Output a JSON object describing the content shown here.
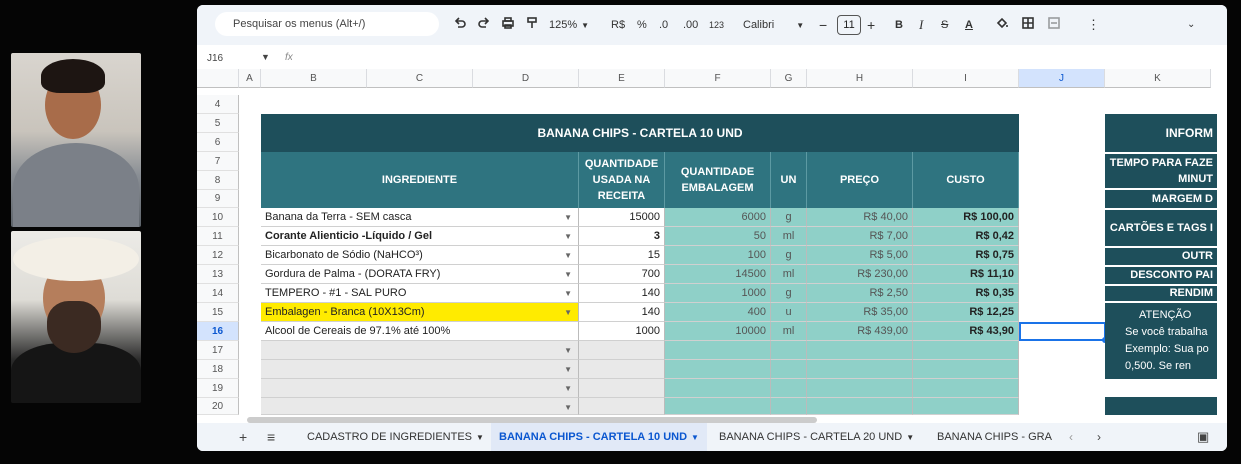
{
  "toolbar": {
    "search_placeholder": "Pesquisar os menus (Alt+/)",
    "zoom": "125%",
    "currency": "R$",
    "percent": "%",
    "dec_decrease": ".0",
    "dec_increase": ".00",
    "number_format": "123",
    "font": "Calibri",
    "font_size": "11",
    "bold": "B",
    "italic": "I",
    "strike": "S",
    "text_color": "A"
  },
  "formula_bar": {
    "cell_ref": "J16",
    "fx": "fx"
  },
  "columns": [
    "A",
    "B",
    "C",
    "D",
    "E",
    "F",
    "G",
    "H",
    "I",
    "J",
    "K"
  ],
  "rows": [
    "4",
    "5",
    "6",
    "7",
    "8",
    "9",
    "10",
    "11",
    "12",
    "13",
    "14",
    "15",
    "16",
    "17",
    "18",
    "19",
    "20"
  ],
  "table": {
    "title": "BANANA CHIPS - CARTELA 10 UND",
    "headers": {
      "ingrediente": "INGREDIENTE",
      "qtd_receita": [
        "QUANTIDADE",
        "USADA NA",
        "RECEITA"
      ],
      "qtd_embalagem": [
        "QUANTIDADE",
        "EMBALAGEM"
      ],
      "un": "UN",
      "preco": "PREÇO",
      "custo": "CUSTO"
    },
    "items": [
      {
        "ingrediente": "Banana da Terra - SEM casca",
        "qtd": "15000",
        "emb": "6000",
        "un": "g",
        "preco": "R$ 40,00",
        "custo": "R$ 100,00"
      },
      {
        "ingrediente": "Corante Alienticio -Líquido / Gel",
        "qtd": "3",
        "emb": "50",
        "un": "ml",
        "preco": "R$ 7,00",
        "custo": "R$ 0,42"
      },
      {
        "ingrediente": "Bicarbonato de Sódio (NaHCO³)",
        "qtd": "15",
        "emb": "100",
        "un": "g",
        "preco": "R$ 5,00",
        "custo": "R$ 0,75"
      },
      {
        "ingrediente": "Gordura de Palma - (DORATA FRY)",
        "qtd": "700",
        "emb": "14500",
        "un": "ml",
        "preco": "R$ 230,00",
        "custo": "R$ 11,10"
      },
      {
        "ingrediente": "TEMPERO - #1 - SAL PURO",
        "qtd": "140",
        "emb": "1000",
        "un": "g",
        "preco": "R$ 2,50",
        "custo": "R$ 0,35"
      },
      {
        "ingrediente": "Embalagen - Branca (10X13Cm)",
        "qtd": "140",
        "emb": "400",
        "un": "u",
        "preco": "R$ 35,00",
        "custo": "R$ 12,25"
      },
      {
        "ingrediente": "Alcool de Cereais de 97.1% até 100%",
        "qtd": "1000",
        "emb": "10000",
        "un": "ml",
        "preco": "R$ 439,00",
        "custo": "R$ 43,90"
      }
    ]
  },
  "info_panel": {
    "title": "INFORM",
    "tempo": "TEMPO PARA FAZE",
    "tempo2": "MINUT",
    "margem": "MARGEM D",
    "cartoes": "CARTÕES E TAGS I",
    "outros": "OUTR",
    "desconto": "DESCONTO PAI",
    "rendimento": "RENDIM",
    "atencao": "ATENÇÃO",
    "note1": "Se você trabalha",
    "note2": "Exemplo: Sua po",
    "note3": "0,500. Se ren"
  },
  "tabs": [
    {
      "label": "CADASTRO DE INGREDIENTES"
    },
    {
      "label": "BANANA CHIPS - CARTELA 10 UND"
    },
    {
      "label": "BANANA CHIPS - CARTELA 20 UND"
    },
    {
      "label": "BANANA CHIPS - GRA"
    }
  ],
  "colors": {
    "dark_teal": "#1e4f5b",
    "header_teal": "#2f7480",
    "light_teal": "#8fd0c8",
    "highlight": "#ffeb00"
  }
}
